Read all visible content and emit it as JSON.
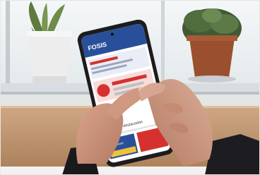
{
  "photo": {
    "subject": "hands holding smartphone showing FOSIS website",
    "screen": {
      "logo_text": "FOSIS",
      "section_heading": "Iniciativas destacadas",
      "card_label": "Iniciativas"
    },
    "colors": {
      "window_light": "#eef2f4",
      "frame_gray": "#b9c0c4",
      "table_wood": "#c9a27c",
      "phone_body": "#1c1c1e",
      "screen_header": "#2a4f9a",
      "accent_red": "#d5322f",
      "skin": "#c9937c",
      "sleeve_dark": "#1a1a1d"
    },
    "icons": [
      "potted-plant-left",
      "potted-plant-right",
      "smartphone",
      "hands"
    ]
  }
}
